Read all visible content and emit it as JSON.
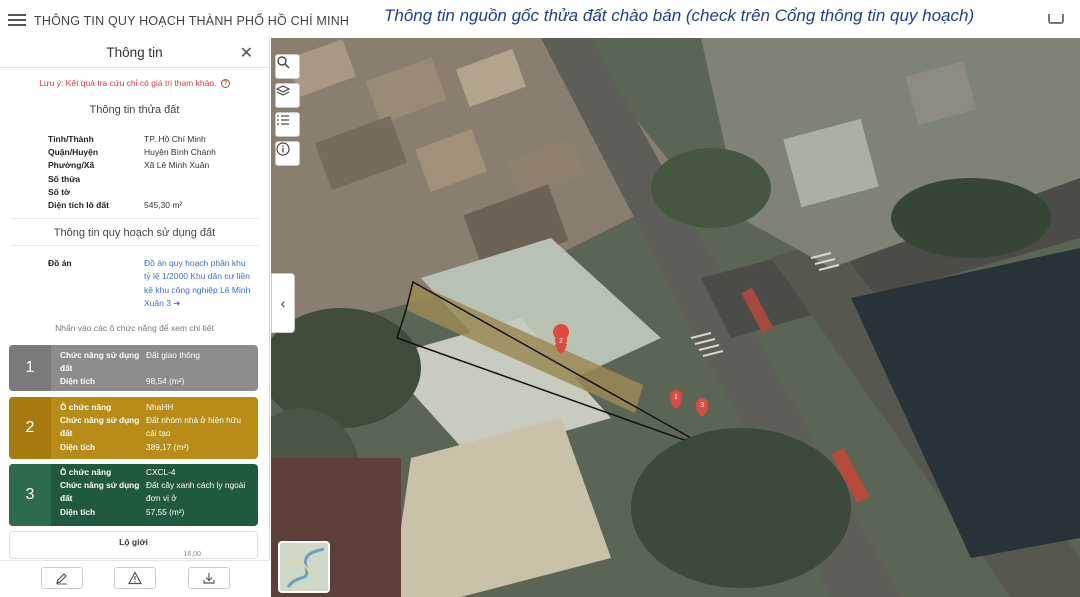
{
  "app_title": "THÔNG TIN QUY HOẠCH THÀNH PHỐ HỒ CHÍ MINH",
  "overlay_caption": "Thông tin nguồn gốc thửa đất chào bán (check trên Cổng thông tin quy hoạch)",
  "panel": {
    "title": "Thông tin",
    "close": "✕",
    "note": "Lưu ý: Kết quả tra cứu chỉ có giá trị tham khảo.",
    "note_icon": "?",
    "section_parcel": "Thông tin thửa đất",
    "parcel": [
      {
        "label": "Tỉnh/Thành",
        "value": "TP. Hồ Chí Minh"
      },
      {
        "label": "Quận/Huyện",
        "value": "Huyện Bình Chánh"
      },
      {
        "label": "Phường/Xã",
        "value": "Xã Lê Minh Xuân"
      },
      {
        "label": "Số thửa",
        "value": ""
      },
      {
        "label": "Số tờ",
        "value": ""
      },
      {
        "label": "Diện tích lô đất",
        "value": "545,30 m²"
      }
    ],
    "section_planning": "Thông tin quy hoạch sử dụng đất",
    "doan_label": "Đồ án",
    "doan_link": "Đồ án quy hoạch phân khu tỷ lệ 1/2000 Khu dân cư liền kề khu công nghiệp Lê Minh Xuân 3 ➔",
    "hint": "Nhấn vào các ô chức năng để xem chi tiết",
    "cards": [
      {
        "num": "1",
        "rows": [
          {
            "k": "Chức năng sử dụng đất",
            "v": "Đất giao thông"
          },
          {
            "k": "Diện tích",
            "v": "98,54 (m²)"
          }
        ]
      },
      {
        "num": "2",
        "rows": [
          {
            "k": "Ô chức năng",
            "v": "NhaHH"
          },
          {
            "k": "Chức năng sử dụng đất",
            "v": "Đất nhóm nhà ở hiện hữu cải tạo"
          },
          {
            "k": "Diện tích",
            "v": "389,17 (m²)"
          }
        ]
      },
      {
        "num": "3",
        "rows": [
          {
            "k": "Ô chức năng",
            "v": "CXCL-4"
          },
          {
            "k": "Chức năng sử dụng đất",
            "v": "Đất cây xanh cách ly ngoài đơn vị ở"
          },
          {
            "k": "Diện tích",
            "v": "57,55 (m²)"
          }
        ]
      }
    ],
    "logioi_title": "Lộ giới",
    "logioi_value": "16,00",
    "bottom_icons": [
      "edit-icon",
      "warning-icon",
      "download-icon"
    ]
  },
  "map": {
    "tools": [
      "search-icon",
      "layers-icon",
      "list-icon",
      "info-icon"
    ],
    "markers": [
      "1",
      "2",
      "3"
    ],
    "collapse": "‹"
  }
}
